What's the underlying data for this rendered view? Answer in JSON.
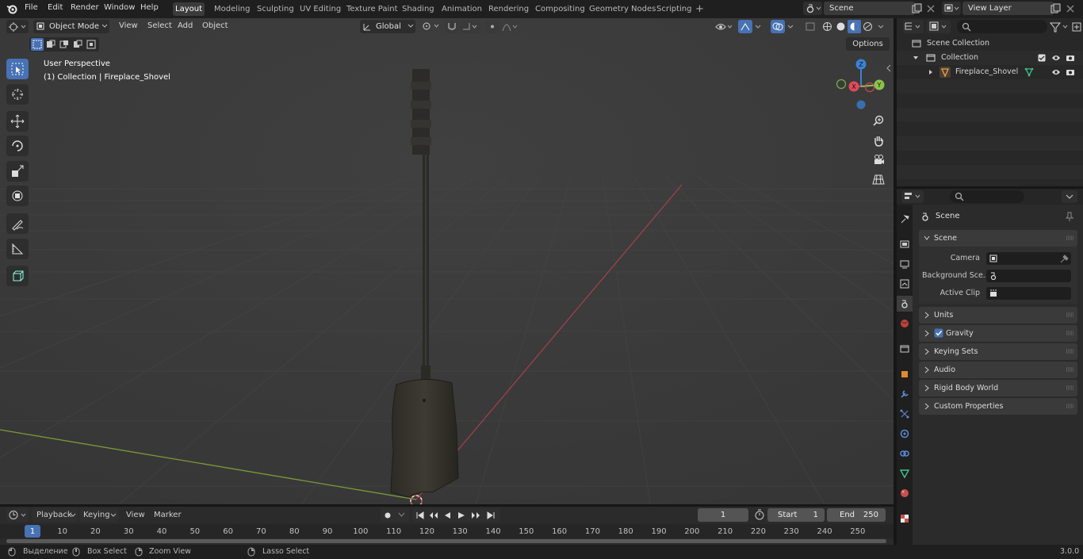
{
  "topbar": {
    "menus": [
      "File",
      "Edit",
      "Render",
      "Window",
      "Help"
    ],
    "workspaces": [
      "Layout",
      "Modeling",
      "Sculpting",
      "UV Editing",
      "Texture Paint",
      "Shading",
      "Animation",
      "Rendering",
      "Compositing",
      "Geometry Nodes",
      "Scripting"
    ],
    "active_workspace": "Layout",
    "add_tab": "+",
    "scene_name": "Scene",
    "view_layer": "View Layer"
  },
  "viewport_header": {
    "mode": "Object Mode",
    "menus": [
      "View",
      "Select",
      "Add",
      "Object"
    ],
    "transform_orientation": "Global",
    "options_label": "Options"
  },
  "viewport": {
    "view_label": "User Perspective",
    "object_label": "(1) Collection | Fireplace_Shovel",
    "gizmo_axes": {
      "x": "X",
      "y": "Y",
      "z": "Z"
    }
  },
  "outliner": {
    "rows": [
      {
        "label": "Scene Collection"
      },
      {
        "label": "Collection"
      },
      {
        "label": "Fireplace_Shovel"
      }
    ]
  },
  "properties": {
    "context_title": "Scene",
    "panel_scene": "Scene",
    "fields": [
      {
        "label": "Camera"
      },
      {
        "label": "Background Sce..."
      },
      {
        "label": "Active Clip"
      }
    ],
    "collapsed_panels": [
      "Units",
      "Gravity",
      "Keying Sets",
      "Audio",
      "Rigid Body World",
      "Custom Properties"
    ],
    "gravity_checked": true
  },
  "timeline": {
    "menus": [
      "Playback",
      "Keying",
      "View",
      "Marker"
    ],
    "current_frame": "1",
    "start_label": "Start",
    "start_value": "1",
    "end_label": "End",
    "end_value": "250",
    "ticks": [
      "1",
      "10",
      "20",
      "30",
      "40",
      "50",
      "60",
      "70",
      "80",
      "90",
      "100",
      "110",
      "120",
      "130",
      "140",
      "150",
      "160",
      "170",
      "180",
      "190",
      "200",
      "210",
      "220",
      "230",
      "240",
      "250"
    ]
  },
  "statusbar": {
    "items": [
      "Выделение",
      "Box Select",
      "Zoom View",
      "Lasso Select"
    ],
    "version": "3.0.0"
  },
  "colors": {
    "accent": "#4772b3",
    "x_axis": "#e04a5a",
    "y_axis": "#8bc34a",
    "z_axis": "#3b82d6"
  }
}
